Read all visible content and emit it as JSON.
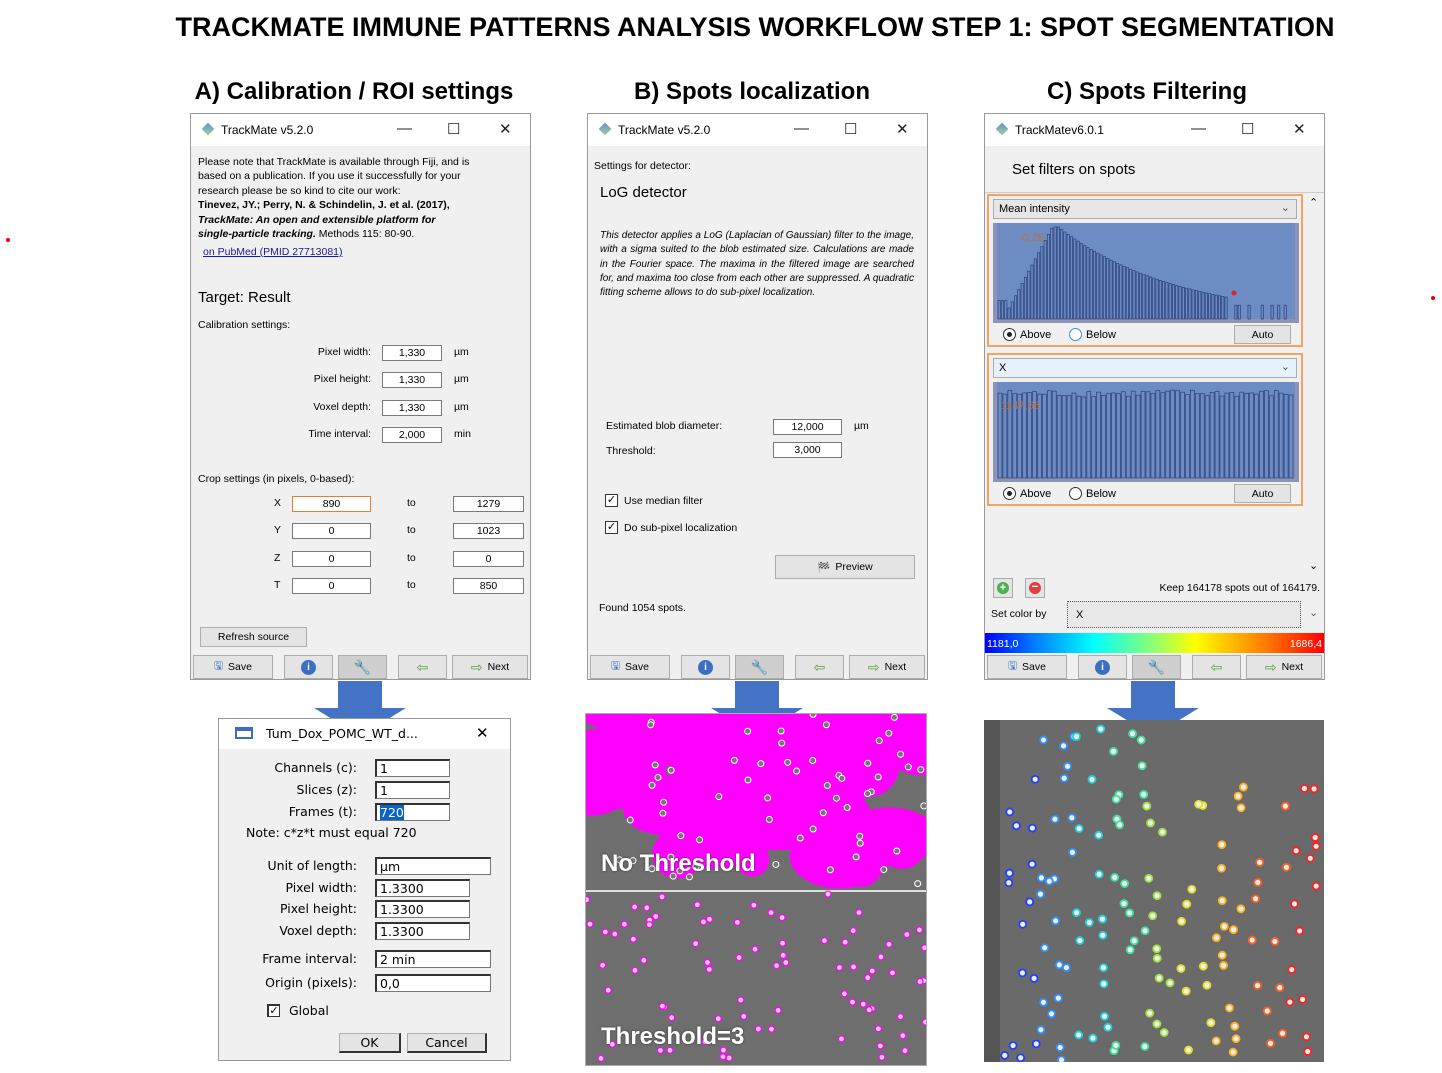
{
  "title": "TRACKMATE IMMUNE PATTERNS ANALYSIS WORKFLOW STEP 1: SPOT SEGMENTATION",
  "panels": {
    "a": "A) Calibration / ROI settings",
    "b": "B) Spots localization",
    "c": "C) Spots Filtering"
  },
  "colors": {
    "arrow": "#4472c4",
    "magenta": "#ff00ff",
    "panel_border": "#f4a460",
    "hist_fill": "#6d8cc4"
  },
  "window_controls": {
    "minimize": "—",
    "maximize": "☐",
    "close": "✕"
  },
  "toolbar": {
    "save": "Save",
    "next": "Next"
  },
  "win_a": {
    "title": "TrackMate v5.2.0",
    "notice": [
      "Please note that TrackMate is available through Fiji, and is",
      "based on a publication. If you use it successfully for your",
      "research please be so kind to cite our work:"
    ],
    "citation_authors": "Tinevez, JY.; Perry, N. & Schindelin, J. et al. (2017),",
    "citation_title_1": "TrackMate: An open and extensible platform for",
    "citation_title_2": "single-particle tracking.",
    "citation_journal": " Methods 115: 80-90.",
    "link": "on PubMed (PMID 27713081)",
    "target": "Target: Result",
    "calibration_label": "Calibration settings:",
    "calibration": [
      {
        "label": "Pixel width:",
        "value": "1,330",
        "unit": "µm"
      },
      {
        "label": "Pixel height:",
        "value": "1,330",
        "unit": "µm"
      },
      {
        "label": "Voxel depth:",
        "value": "1,330",
        "unit": "µm"
      },
      {
        "label": "Time interval:",
        "value": "2,000",
        "unit": "min"
      }
    ],
    "crop_label": "Crop settings (in pixels, 0-based):",
    "to": "to",
    "crop": [
      {
        "axis": "X",
        "from": "890",
        "to": "1279"
      },
      {
        "axis": "Y",
        "from": "0",
        "to": "1023"
      },
      {
        "axis": "Z",
        "from": "0",
        "to": "0"
      },
      {
        "axis": "T",
        "from": "0",
        "to": "850"
      }
    ],
    "refresh": "Refresh source"
  },
  "win_b": {
    "title": "TrackMate v5.2.0",
    "settings_label": "Settings for detector:",
    "detector": "LoG detector",
    "description": "This detector applies a LoG (Laplacian of Gaussian) filter to the image, with a sigma suited to the blob estimated size. Calculations are made in the Fourier space. The maxima in the filtered image are searched for, and maxima too close from each other are suppressed. A quadratic fitting scheme allows to do sub-pixel localization.",
    "blob_label": "Estimated blob diameter:",
    "blob_value": "12,000",
    "blob_unit": "µm",
    "threshold_label": "Threshold:",
    "threshold_value": "3,000",
    "median": "Use median filter",
    "subpixel": "Do sub-pixel localization",
    "median_checked": true,
    "subpixel_checked": true,
    "preview": "Preview",
    "found": "Found 1054 spots."
  },
  "win_c": {
    "title": "TrackMatev6.0.1",
    "heading": "Set filters on spots",
    "filters": [
      {
        "feature": "Mean intensity",
        "threshold": "-0,26",
        "above": "Above",
        "below": "Below",
        "auto": "Auto",
        "mode": "above"
      },
      {
        "feature": "X",
        "threshold": "1147,66",
        "above": "Above",
        "below": "Below",
        "auto": "Auto",
        "mode": "above"
      }
    ],
    "keep": "Keep 164178 spots out of  164179.",
    "color_by_label": "Set color by",
    "color_by": "X",
    "cmap_min": "1181,0",
    "cmap_max": "1686,4"
  },
  "dialog": {
    "title": "Tum_Dox_POMC_WT_d...",
    "fields1": [
      {
        "label": "Channels (c):",
        "value": "1"
      },
      {
        "label": "Slices (z):",
        "value": "1"
      },
      {
        "label": "Frames (t):",
        "value": "720"
      }
    ],
    "note": "Note: c*z*t must equal 720",
    "fields2": [
      {
        "label": "Unit of length:",
        "value": "µm"
      },
      {
        "label": "Pixel width:",
        "value": "1.3300"
      },
      {
        "label": "Pixel height:",
        "value": "1.3300"
      },
      {
        "label": "Voxel depth:",
        "value": "1.3300"
      }
    ],
    "fields3": [
      {
        "label": "Frame interval:",
        "value": "2 min"
      },
      {
        "label": "Origin (pixels):",
        "value": "0,0"
      }
    ],
    "global": "Global",
    "ok": "OK",
    "cancel": "Cancel"
  },
  "images": {
    "no_threshold": "No Threshold",
    "threshold": "Threshold=3"
  }
}
